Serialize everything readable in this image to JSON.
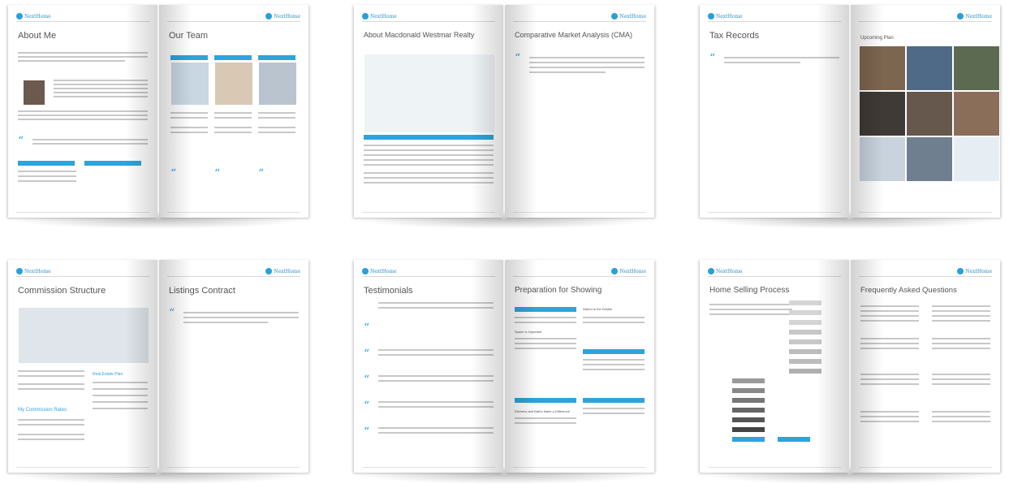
{
  "brand": {
    "logo_text": "NextHome",
    "accent": "#2ea3dc"
  },
  "spreads": [
    {
      "left_title": "About Me",
      "right_title": "Our Team"
    },
    {
      "left_title": "About Macdonald Westmar Realty",
      "right_title": "Comparative Market Analysis (CMA)"
    },
    {
      "left_title": "Tax Records",
      "right_title": "Upcoming Plan"
    },
    {
      "left_title": "Commission Structure",
      "right_title": "Listings Contract"
    },
    {
      "left_title": "Testimonials",
      "right_title": "Preparation for Showing"
    },
    {
      "left_title": "Home Selling Process",
      "right_title": "Frequently Asked Questions"
    }
  ],
  "sub_headings": {
    "commission_right_label": "Real Estate Plan",
    "commission_sub": "My Commission Rates",
    "prep_sub1": "Space is Important",
    "prep_sub2": "Kitchens and Baths Make a Difference",
    "prep_sub3": "Attend to the Details"
  }
}
